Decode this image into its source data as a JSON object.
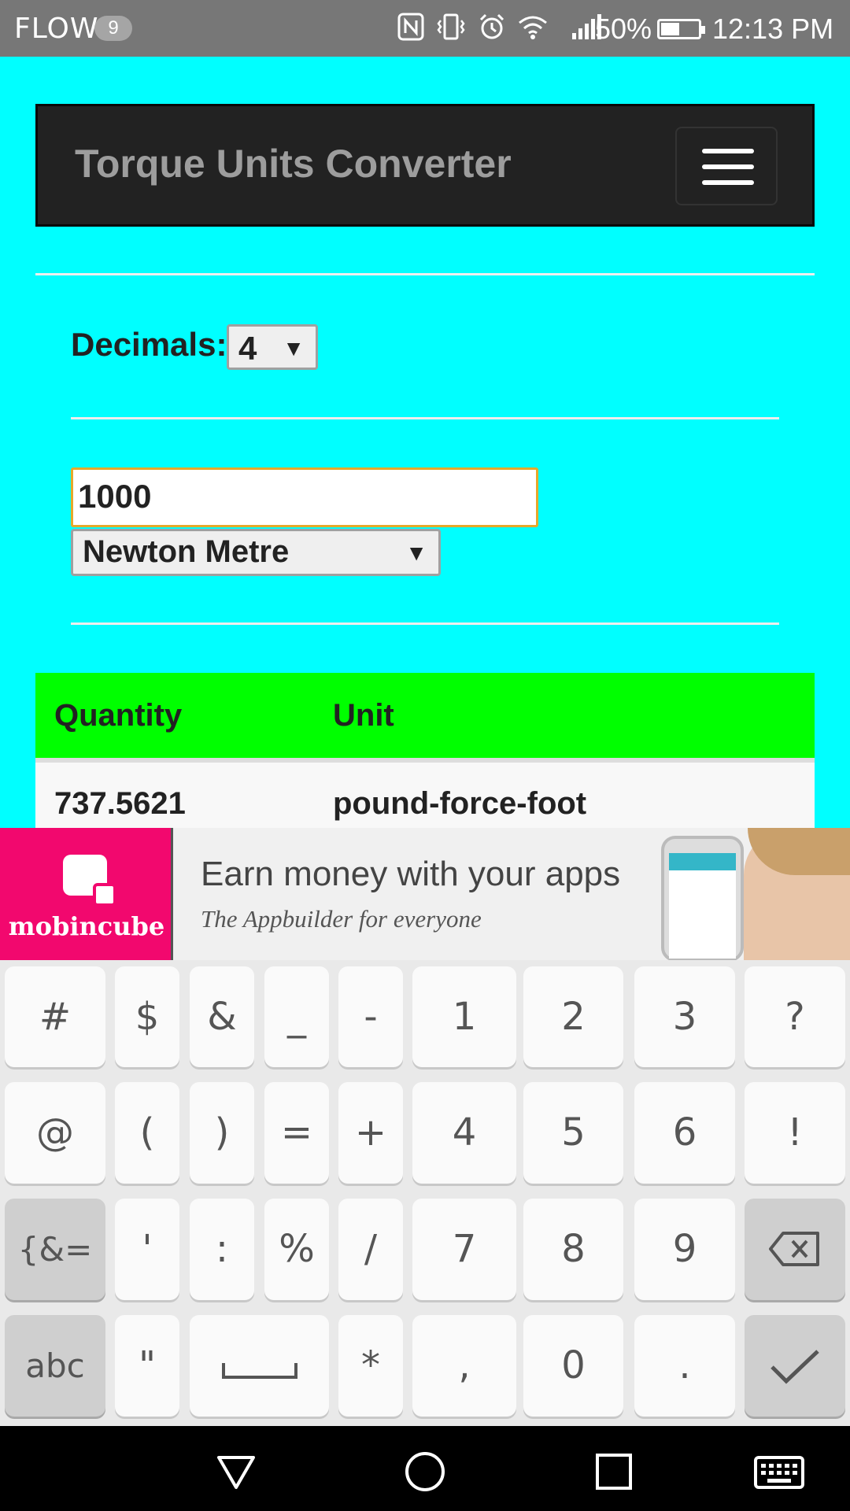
{
  "status_bar": {
    "carrier": "FLOW",
    "notification_count": "9",
    "battery_percent": "50%",
    "battery_level": 0.5,
    "time": "12:13 PM",
    "icons": [
      "nfc-icon",
      "vibrate-icon",
      "alarm-icon",
      "wifi-icon",
      "signal-icon",
      "battery-icon"
    ]
  },
  "header": {
    "title": "Torque Units Converter",
    "menu_icon": "hamburger-menu-icon"
  },
  "form": {
    "decimals_label": "Decimals:",
    "decimals_value": "4",
    "quantity_value": "1000",
    "unit_value": "Newton Metre"
  },
  "table": {
    "headers": [
      "Quantity",
      "Unit"
    ],
    "rows": [
      {
        "quantity": "737.5621",
        "unit": "pound-force-foot"
      }
    ]
  },
  "ad": {
    "brand": "mobincube",
    "headline": "Earn money with your apps",
    "subline": "The Appbuilder for everyone"
  },
  "keyboard": {
    "row1": [
      "#",
      "$",
      "&",
      "_",
      "-",
      "1",
      "2",
      "3",
      "?"
    ],
    "row2": [
      "@",
      "(",
      ")",
      "=",
      "+",
      "4",
      "5",
      "6",
      "!"
    ],
    "row3": [
      "{&=",
      "'",
      ":",
      "%",
      "/",
      "7",
      "8",
      "9"
    ],
    "row4": [
      "abc",
      "\"",
      "*",
      ",",
      "0",
      "."
    ],
    "icons": [
      "backspace-icon",
      "space-icon",
      "enter-check-icon"
    ]
  },
  "nav_bar": {
    "icons": [
      "back-icon",
      "home-icon",
      "recents-icon",
      "keyboard-switch-icon"
    ]
  },
  "colors": {
    "page_bg": "#00ffff",
    "table_header_bg": "#00ff00",
    "input_focus_border": "#e5a92b",
    "ad_brand": "#f2086e",
    "navbar_bg": "#222222"
  }
}
